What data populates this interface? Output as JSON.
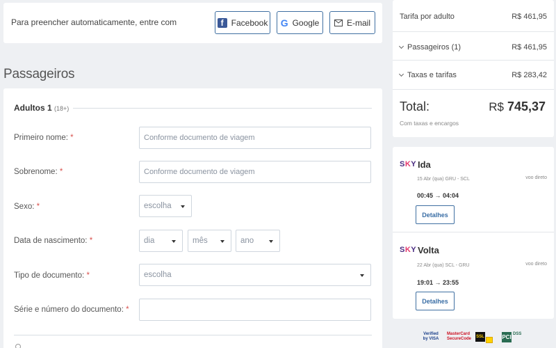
{
  "social": {
    "prompt": "Para preencher automaticamente, entre com",
    "facebook_label": "Facebook",
    "google_label": "Google",
    "email_label": "E-mail"
  },
  "section_title": "Passageiros",
  "form": {
    "adult_title": "Adultos 1",
    "adult_sub": "(18+)",
    "first_name": {
      "label": "Primeiro nome:",
      "placeholder": "Conforme documento de viagem"
    },
    "last_name": {
      "label": "Sobrenome:",
      "placeholder": "Conforme documento de viagem"
    },
    "sex": {
      "label": "Sexo:",
      "value": "escolha"
    },
    "birth": {
      "label": "Data de nascimento:",
      "day": "dia",
      "month": "mês",
      "year": "ano"
    },
    "doc_type": {
      "label": "Tipo de documento:",
      "value": "escolha"
    },
    "doc_number": {
      "label": "Série e número do documento:",
      "value": ""
    },
    "required_mark": "*"
  },
  "summary": {
    "fare_label": "Tarifa por adulto",
    "fare_amount": "R$ 461,95",
    "passengers_label": "Passageiros (1)",
    "passengers_amount": "R$ 461,95",
    "taxes_label": "Taxas e tarifas",
    "taxes_amount": "R$ 283,42",
    "total_label": "Total:",
    "total_currency": "R$",
    "total_value": "745,37",
    "total_note": "Com taxas e encargos"
  },
  "flights": {
    "airline_logo": "SKY",
    "outbound": {
      "title": "Ida",
      "date_route": "15 Abr (qua) GRU - SCL",
      "type": "voo direto",
      "times": "00:45 → 04:04",
      "details_label": "Detalhes"
    },
    "return": {
      "title": "Volta",
      "date_route": "22 Abr (qua) SCL - GRU",
      "type": "voo direto",
      "times": "19:01 → 23:55",
      "details_label": "Detalhes"
    }
  },
  "badges": {
    "verified": "Verified by VISA",
    "mastercard": "MasterCard SecureCode",
    "ssl": "SSL",
    "pci": "PCI",
    "dss": "DSS"
  }
}
